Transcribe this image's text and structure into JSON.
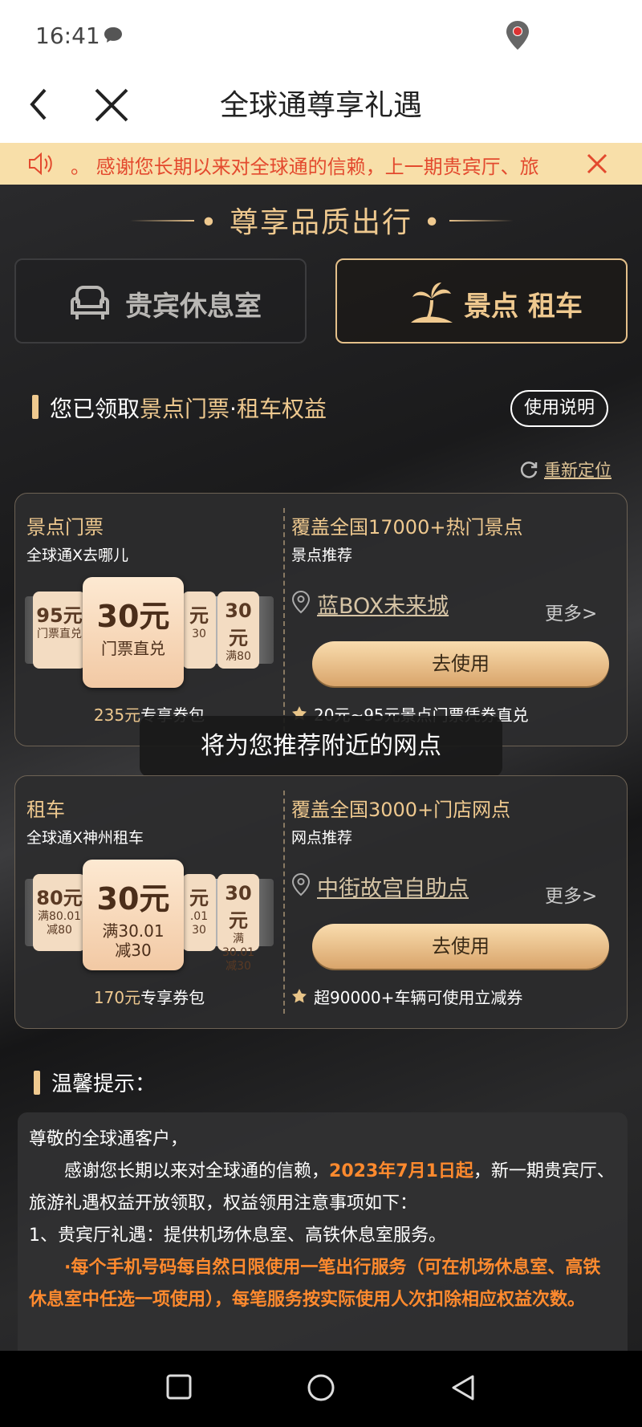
{
  "status_bar": {
    "time": "16:41"
  },
  "header": {
    "title": "全球通尊享礼遇"
  },
  "notice": {
    "text": "。 感谢您长期以来对全球通的信赖，上一期贵宾厅、旅"
  },
  "hero": {
    "title": "尊享品质出行"
  },
  "tabs": [
    {
      "label": "贵宾休息室",
      "active": false
    },
    {
      "label": "景点 租车",
      "active": true
    }
  ],
  "section": {
    "prefix": "您已领取",
    "highlight": "景点门票",
    "dot": "·",
    "suffix": "租车权益",
    "help_button": "使用说明",
    "relocate": "重新定位"
  },
  "cards": [
    {
      "title": "景点门票",
      "subtitle": "全球通X去哪儿",
      "ticket_main": {
        "value": "30元",
        "sub": "门票直兑"
      },
      "ticket_left": {
        "value": "95元",
        "sub": "门票直兑"
      },
      "ticket_right": {
        "value": "元",
        "sub": "30"
      },
      "ticket_far": {
        "value": "30元",
        "sub": "满80"
      },
      "pack_amount": "235元",
      "pack_label": "专享券包",
      "right_title": "覆盖全国17000+热门景点",
      "right_sub": "景点推荐",
      "place": "蓝BOX未来城",
      "more": "更多>",
      "use_button": "去使用",
      "note": "20元~95元景点门票凭券直兑"
    },
    {
      "title": "租车",
      "subtitle": "全球通X神州租车",
      "ticket_main": {
        "value": "30元",
        "sub": "满30.01\n减30"
      },
      "ticket_left": {
        "value": "80元",
        "sub": "满80.01\n减80"
      },
      "ticket_right": {
        "value": "元",
        "sub": ".01\n30"
      },
      "ticket_far": {
        "value": "30元",
        "sub": "满30.01\n减30"
      },
      "pack_amount": "170元",
      "pack_label": "专享券包",
      "right_title": "覆盖全国3000+门店网点",
      "right_sub": "网点推荐",
      "place": "中街故宫自助点",
      "more": "更多>",
      "use_button": "去使用",
      "note": "超90000+车辆可使用立减券"
    }
  ],
  "toast": "将为您推荐附近的网点",
  "tips": {
    "title": "温馨提示：",
    "greeting": "尊敬的全球通客户，",
    "para1_a": "感谢您长期以来对全球通的信赖，",
    "para1_date": "2023年7月1日起",
    "para1_b": "，新一期贵宾厅、旅游礼遇权益开放领取，权益领用注意事项如下：",
    "item1": "1、贵宾厅礼遇：提供机场休息室、高铁休息室服务。",
    "item1_rule": "·每个手机号码每自然日限使用一笔出行服务（可在机场休息室、高铁休息室中任选一项使用），每笔服务按实际使用人次扣除相应权益次数。"
  },
  "colors": {
    "accent": "#efc98f",
    "notice_bg": "#f8dfa9",
    "notice_text": "#e34a2e",
    "highlight_orange": "#ff8a2e"
  }
}
